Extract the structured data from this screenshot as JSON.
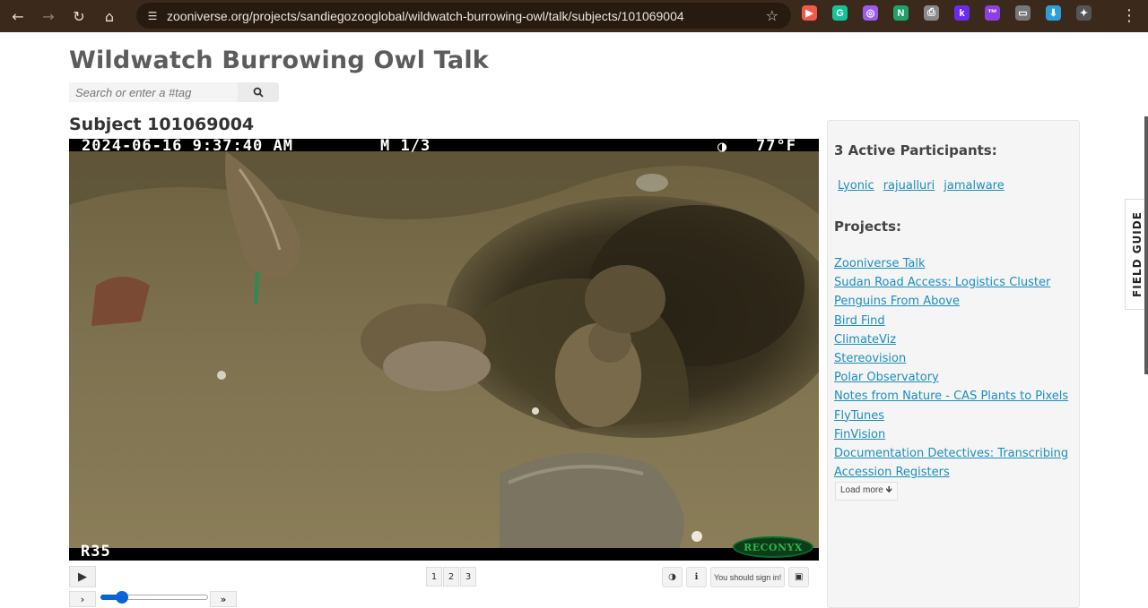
{
  "browser": {
    "url": "zooniverse.org/projects/sandiegozooglobal/wildwatch-burrowing-owl/talk/subjects/101069004",
    "nav_icons": [
      "back-icon",
      "forward-icon",
      "reload-icon",
      "home-icon"
    ],
    "extensions": [
      {
        "name": "cast-ext-icon",
        "color": "#f05a4a",
        "glyph": "▶"
      },
      {
        "name": "grammarly-ext-icon",
        "color": "#15c39a",
        "glyph": "G"
      },
      {
        "name": "color-ext-icon",
        "color": "#9b5cf0",
        "glyph": "◎"
      },
      {
        "name": "notion-ext-icon",
        "color": "#22a06b",
        "glyph": "N"
      },
      {
        "name": "printer-ext-icon",
        "color": "#8a8a8a",
        "glyph": "⎙"
      },
      {
        "name": "k-ext-icon",
        "color": "#6c2cf0",
        "glyph": "k"
      },
      {
        "name": "tm-ext-icon",
        "color": "#8e3fe0",
        "glyph": "™"
      },
      {
        "name": "reader-ext-icon",
        "color": "#777777",
        "glyph": "▭"
      },
      {
        "name": "download-ext-icon",
        "color": "#2d9fd8",
        "glyph": "⬇"
      },
      {
        "name": "puzzle-ext-icon",
        "color": "#555555",
        "glyph": "✦"
      }
    ]
  },
  "header": {
    "title": "Wildwatch Burrowing Owl Talk",
    "search_placeholder": "Search or enter a #tag"
  },
  "subject": {
    "title": "Subject 101069004",
    "osd_datetime": "2024-06-16  9:37:40 AM",
    "osd_frame": "M 1/3",
    "osd_moon": "◑",
    "osd_temp": "77°F",
    "osd_camera": "R35",
    "brand": "RECONYX"
  },
  "controls": {
    "play_icon": "▶",
    "frames": [
      "1",
      "2",
      "3"
    ],
    "contrast_icon": "◑",
    "info_icon": "ℹ",
    "sign_in_text": "You should sign in!",
    "image_icon": "▣",
    "step_back": "›",
    "step_forward": "»",
    "slider_value": 0.2
  },
  "sidebar": {
    "participants_heading": "3 Active Participants:",
    "participants": [
      "Lyonic",
      "rajualluri",
      "jamalware"
    ],
    "projects_heading": "Projects:",
    "projects": [
      "Zooniverse Talk",
      "Sudan Road Access: Logistics Cluster",
      "Penguins From Above",
      "Bird Find",
      "ClimateViz",
      "Stereovision",
      "Polar Observatory",
      "Notes from Nature - CAS Plants to Pixels",
      "FlyTunes",
      "FinVision",
      "Documentation Detectives: Transcribing",
      "Accession Registers"
    ],
    "load_more": "Load more 🡻"
  },
  "field_guide": "FIELD GUIDE"
}
